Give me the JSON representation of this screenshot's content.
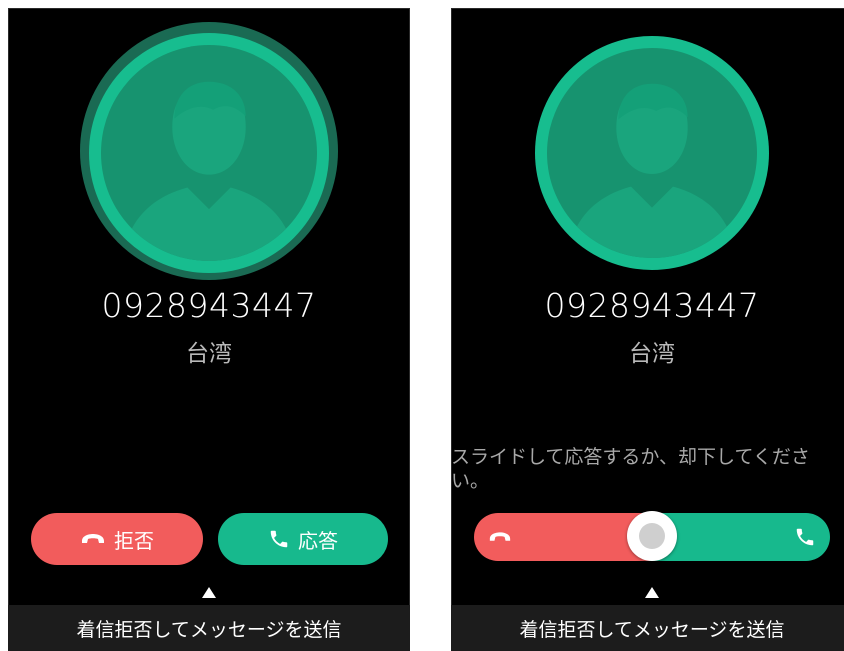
{
  "colors": {
    "background": "#000000",
    "avatar_ring": "#17bd8f",
    "avatar_fill": "#17936f",
    "reject": "#f25c5c",
    "accept": "#17b98d",
    "bottom_bar": "#1c1c1c"
  },
  "screens": [
    {
      "caller": {
        "number": "0928943447",
        "region": "台湾"
      },
      "buttons": {
        "reject_label": "拒否",
        "reject_icon": "phone-hangup-icon",
        "accept_label": "応答",
        "accept_icon": "phone-icon"
      },
      "bottom_bar": {
        "label": "着信拒否してメッセージを送信"
      }
    },
    {
      "caller": {
        "number": "0928943447",
        "region": "台湾"
      },
      "hint": "スライドして応答するか、却下してください。",
      "slider": {
        "left_icon": "phone-hangup-icon",
        "right_icon": "phone-icon"
      },
      "bottom_bar": {
        "label": "着信拒否してメッセージを送信"
      }
    }
  ]
}
